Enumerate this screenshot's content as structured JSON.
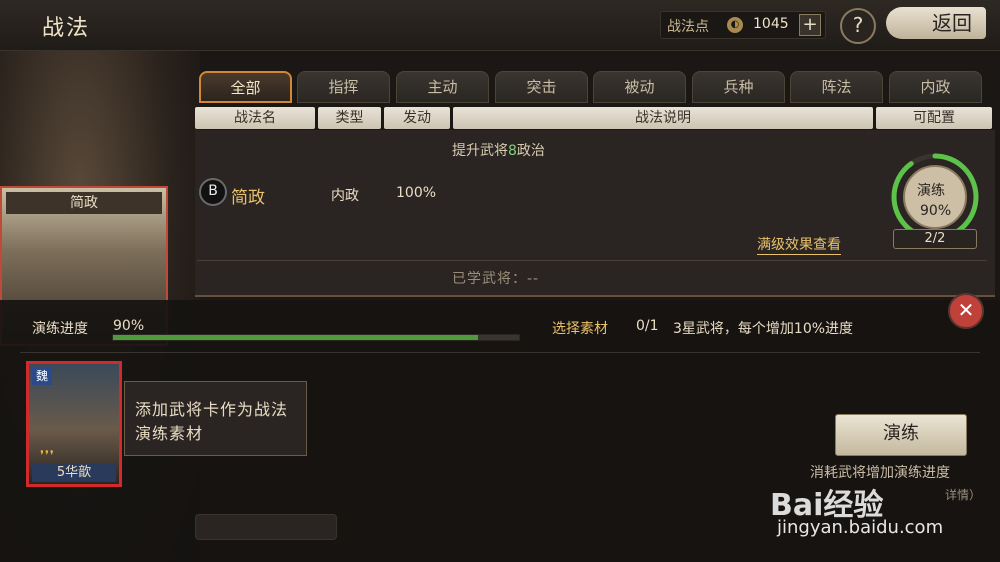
{
  "header": {
    "title": "战法",
    "points_label": "战法点",
    "points_value": "1045",
    "plus_label": "+",
    "help_label": "?",
    "back_label": "返回"
  },
  "tabs": [
    "全部",
    "指挥",
    "主动",
    "突击",
    "被动",
    "兵种",
    "阵法",
    "内政"
  ],
  "active_tab": 0,
  "columns": [
    "战法名",
    "类型",
    "发动",
    "战法说明",
    "可配置"
  ],
  "skill": {
    "grade": "B",
    "name": "简政",
    "type": "内政",
    "rate": "100%",
    "desc_prefix": "提升武将",
    "desc_number": "8",
    "desc_suffix": "政治",
    "full_effect": "满级效果查看",
    "learned_label": "已学武将：--",
    "practice_label": "演练",
    "practice_pct": "90%",
    "practice_progress": 0.9,
    "count": "2/2"
  },
  "card_left_title": "简政",
  "practice": {
    "progress_label": "演练进度",
    "progress_pct": "90%",
    "progress_fraction": 0.9,
    "select_label": "选择素材",
    "material_count": "0/1",
    "material_rule": "3星武将，每个增加10%进度"
  },
  "hero": {
    "faction": "魏",
    "stars": "❜❜❜",
    "name": "5华歆"
  },
  "tooltip": "添加武将卡作为战法演练素材",
  "practice_button": "演练",
  "consume_text": "消耗武将增加演练进度",
  "details_text": "详情）",
  "watermark": {
    "text": "Bai经验",
    "url": "jingyan.baidu.com"
  },
  "colors": {
    "accent_gold": "#e9c16a",
    "tab_active_border": "#d08838",
    "progress_green": "#4f9a3a",
    "close_red": "#c0413a"
  }
}
